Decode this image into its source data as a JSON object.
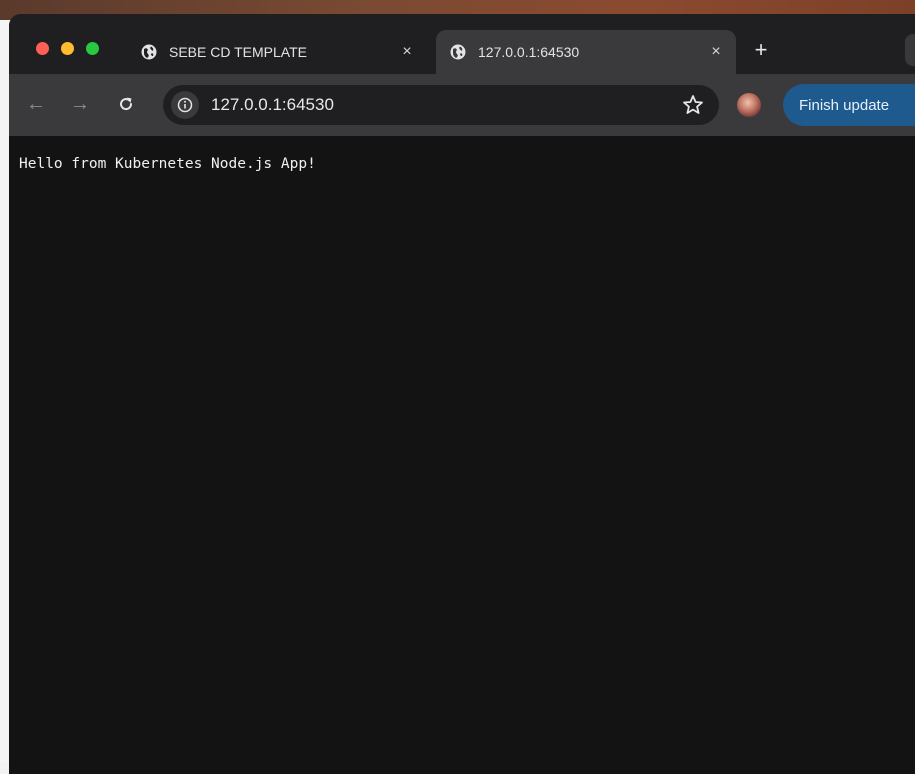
{
  "tabs": [
    {
      "title": "SEBE CD TEMPLATE",
      "close": "×",
      "active": false,
      "icon": "globe-icon"
    },
    {
      "title": "127.0.0.1:64530",
      "close": "×",
      "active": true,
      "icon": "globe-icon"
    }
  ],
  "new_tab_symbol": "+",
  "toolbar": {
    "back_symbol": "←",
    "forward_symbol": "→",
    "reload_symbol": "C",
    "url": "127.0.0.1:64530",
    "update_label": "Finish update"
  },
  "page": {
    "message": "Hello from Kubernetes Node.js App!"
  },
  "colors": {
    "close": "#fe5f57",
    "minimize": "#febc2e",
    "zoom": "#28c840",
    "update_button": "#1e5a8e",
    "page_background": "#131313"
  }
}
